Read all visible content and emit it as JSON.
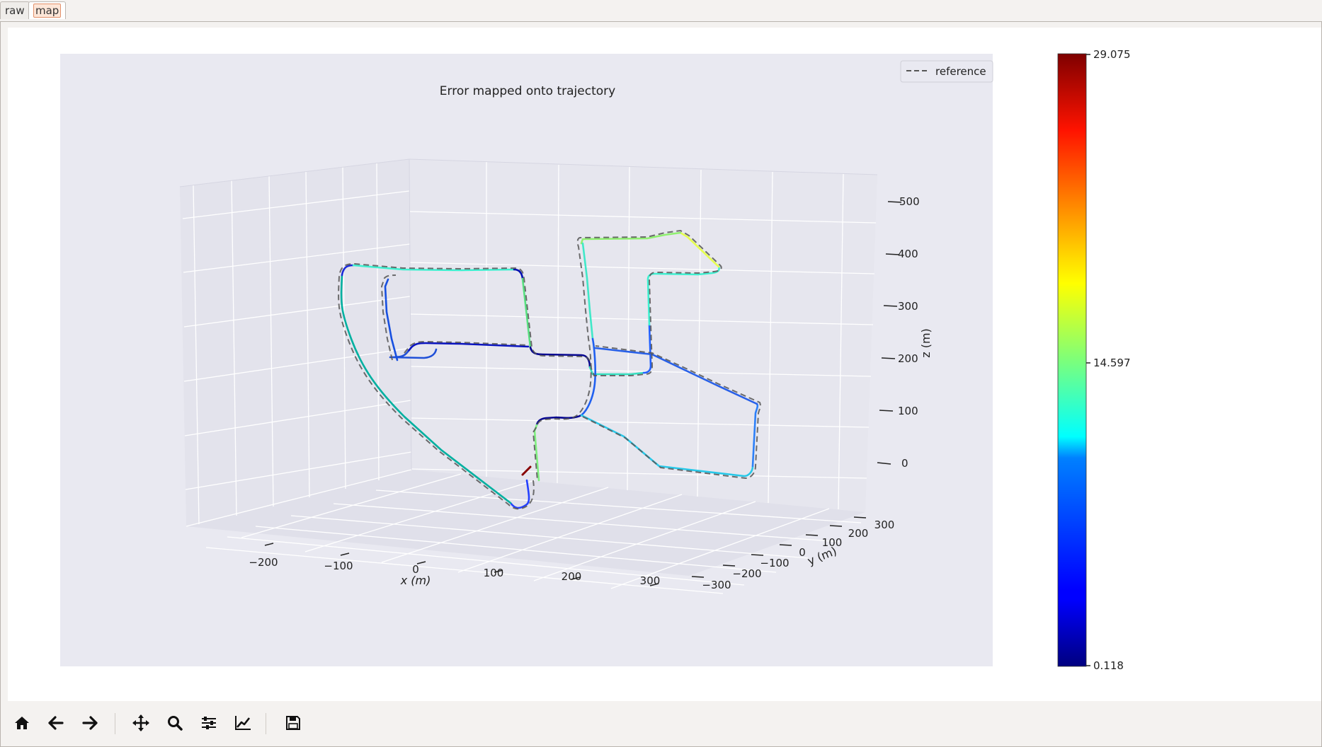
{
  "tabs": [
    {
      "label": "raw",
      "active": false
    },
    {
      "label": "map",
      "active": true
    }
  ],
  "chart_data": {
    "type": "line",
    "title": "Error mapped onto trajectory",
    "xlabel": "x (m)",
    "ylabel": "y (m)",
    "zlabel": "z (m)",
    "x_ticks": [
      "−200",
      "−100",
      "0",
      "100",
      "200",
      "300"
    ],
    "y_ticks": [
      "−300",
      "−200",
      "−100",
      "0",
      "100",
      "200",
      "300"
    ],
    "z_ticks": [
      "0",
      "100",
      "200",
      "300",
      "400",
      "500"
    ],
    "legend": {
      "label": "reference",
      "placement": "top-right"
    },
    "colorbar": {
      "cmap": "jet",
      "min": 0.118,
      "max": 29.075,
      "ticks": [
        "0.118",
        "14.597",
        "29.075"
      ]
    },
    "grid": true,
    "series": [
      {
        "name": "reference",
        "style": "dashed",
        "color": "#555555"
      }
    ]
  },
  "toolbar": {
    "buttons": [
      {
        "name": "home-button",
        "icon": "home-icon"
      },
      {
        "name": "back-button",
        "icon": "arrow-left-icon"
      },
      {
        "name": "forward-button",
        "icon": "arrow-right-icon"
      },
      {
        "name": "pan-button",
        "icon": "move-icon"
      },
      {
        "name": "zoom-button",
        "icon": "magnifier-icon"
      },
      {
        "name": "subplots-button",
        "icon": "sliders-icon"
      },
      {
        "name": "axes-edit-button",
        "icon": "line-chart-icon"
      },
      {
        "name": "save-button",
        "icon": "floppy-disk-icon"
      }
    ]
  }
}
